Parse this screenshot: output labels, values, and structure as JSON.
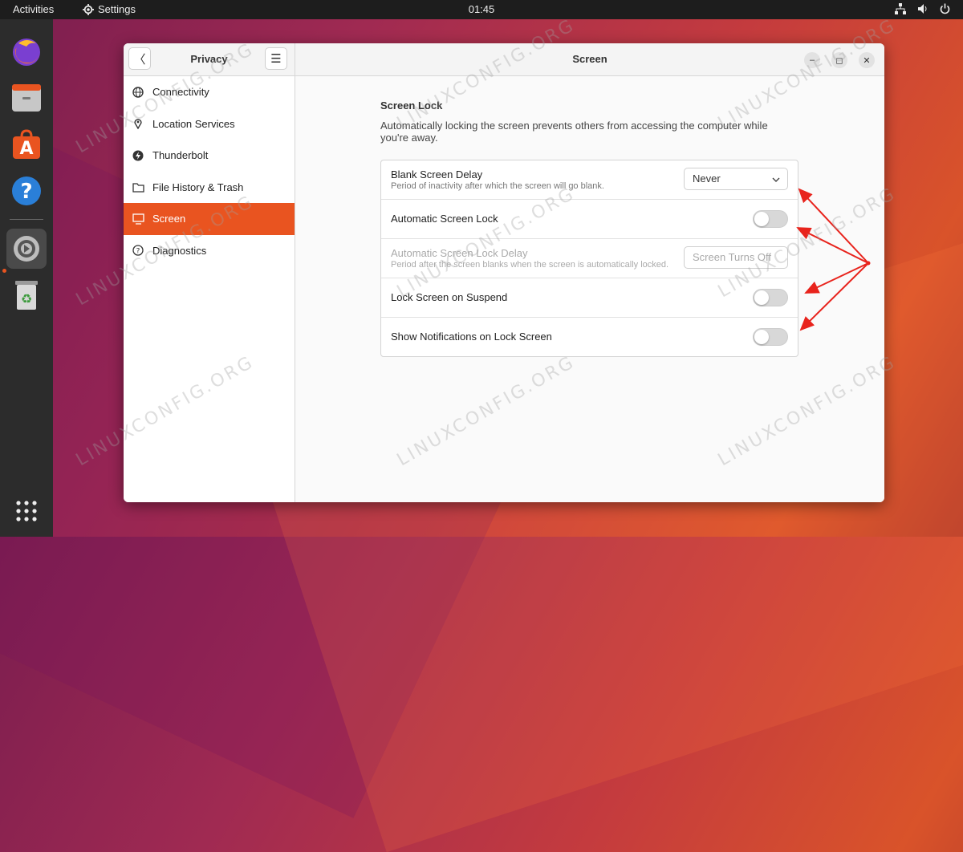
{
  "topbar": {
    "activities": "Activities",
    "app_name": "Settings",
    "clock": "01:45"
  },
  "sidebar": {
    "title": "Privacy",
    "items": [
      {
        "label": "Connectivity",
        "icon": "globe-icon"
      },
      {
        "label": "Location Services",
        "icon": "location-pin-icon"
      },
      {
        "label": "Thunderbolt",
        "icon": "thunderbolt-icon"
      },
      {
        "label": "File History & Trash",
        "icon": "folder-icon"
      },
      {
        "label": "Screen",
        "icon": "monitor-icon",
        "selected": true
      },
      {
        "label": "Diagnostics",
        "icon": "help-circle-icon"
      }
    ]
  },
  "main": {
    "title": "Screen",
    "section_title": "Screen Lock",
    "section_desc": "Automatically locking the screen prevents others from accessing the computer while you're away.",
    "rows": [
      {
        "title": "Blank Screen Delay",
        "subtitle": "Period of inactivity after which the screen will go blank.",
        "control": "dropdown",
        "value": "Never"
      },
      {
        "title": "Automatic Screen Lock",
        "control": "toggle",
        "on": false
      },
      {
        "title": "Automatic Screen Lock Delay",
        "subtitle": "Period after the screen blanks when the screen is automatically locked.",
        "control": "dropdown",
        "value": "Screen Turns Off",
        "disabled": true
      },
      {
        "title": "Lock Screen on Suspend",
        "control": "toggle",
        "on": false
      },
      {
        "title": "Show Notifications on Lock Screen",
        "control": "toggle",
        "on": false
      }
    ]
  },
  "watermark": "LINUXCONFIG.ORG",
  "colors": {
    "accent": "#e95420",
    "annotation": "#e8231c"
  }
}
